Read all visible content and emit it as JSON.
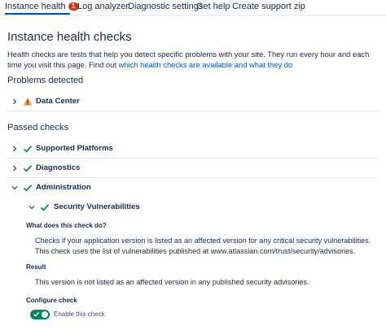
{
  "colors": {
    "link": "#0052cc",
    "warning": "#ff991f",
    "success": "#00875a",
    "badge": "#de350b",
    "toggle_on": "#00875a"
  },
  "tabs": [
    {
      "label": "Instance health",
      "active": true,
      "badge": "1"
    },
    {
      "label": "Log analyzer"
    },
    {
      "label": "Diagnostic settings"
    },
    {
      "label": "Get help"
    },
    {
      "label": "Create support zip"
    }
  ],
  "page": {
    "title": "Instance health checks",
    "description": "Health checks are tests that help you detect specific problems with your site. They run every hour and each time you visit this page. Find out",
    "description_link": "which health checks are available and what they do"
  },
  "problems": {
    "heading": "Problems detected",
    "items": [
      {
        "label": "Data Center",
        "status_icon": "warning-icon",
        "expanded": false
      }
    ]
  },
  "passed": {
    "heading": "Passed checks",
    "items": [
      {
        "label": "Supported Platforms",
        "status_icon": "check-icon",
        "expanded": false
      },
      {
        "label": "Diagnostics",
        "status_icon": "check-icon",
        "expanded": false
      },
      {
        "label": "Administration",
        "status_icon": "check-icon",
        "expanded": true
      }
    ],
    "sub_item": {
      "label": "Security Vulnerabilities",
      "status_icon": "check-icon",
      "expanded": true
    }
  },
  "detail": {
    "what_heading": "What does this check do?",
    "what_text": "Checks if your application version is listed as an affected version for any critical security vulnerabilities. This check uses the list of vulnerabilities published at www.atlassian.com/trust/security/advisories.",
    "result_heading": "Result",
    "result_text": "This version is not listed as an affected version in any published security advisories.",
    "configure_heading": "Configure check",
    "toggle_label": "Enable this check",
    "toggle_on": true
  }
}
